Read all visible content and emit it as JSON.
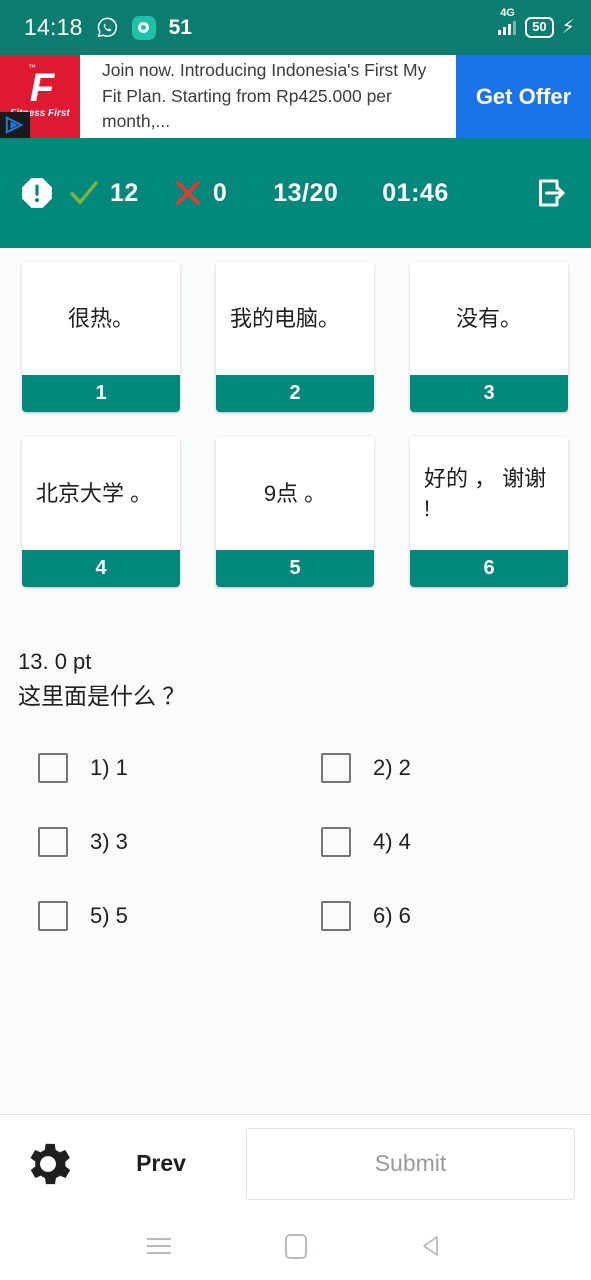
{
  "status_bar": {
    "time": "14:18",
    "whatsapp_icon": "whatsapp-icon",
    "message_icon": "message-icon",
    "notification_count": "51",
    "network_label": "4G",
    "battery_level": "50",
    "charging_icon": "charging-bolt-icon"
  },
  "ad_banner": {
    "brand": "Fitness First",
    "brand_mark": "F",
    "trademark": "™",
    "adchoices_icon": "adchoices-icon",
    "text": "Join now. Introducing Indonesia's First My Fit Plan. Starting from Rp425.000 per month,...",
    "cta_label": "Get Offer",
    "cta_color": "#1a73e8",
    "logo_color": "#e01933"
  },
  "quiz_header": {
    "alert_icon": "alert-octagon-icon",
    "correct_icon": "check-icon",
    "correct_count": "12",
    "wrong_icon": "cross-icon",
    "wrong_count": "0",
    "progress": "13/20",
    "timer": "01:46",
    "exit_icon": "exit-icon",
    "background_color": "#00897b",
    "correct_color": "#7cb342",
    "wrong_color": "#e53935"
  },
  "cards": [
    {
      "text": "很热。",
      "number": "1",
      "align": "center"
    },
    {
      "text": "我的电脑。",
      "number": "2",
      "align": "left"
    },
    {
      "text": "没有。",
      "number": "3",
      "align": "center"
    },
    {
      "text": "北京大学 。",
      "number": "4",
      "align": "left"
    },
    {
      "text": "9点 。",
      "number": "5",
      "align": "center"
    },
    {
      "text": "好的 ， 谢谢 !",
      "number": "6",
      "align": "left"
    }
  ],
  "question": {
    "points": "13. 0 pt",
    "text": "这里面是什么 ？",
    "options": [
      {
        "label": "1) 1",
        "checked": false
      },
      {
        "label": "2) 2",
        "checked": false
      },
      {
        "label": "3) 3",
        "checked": false
      },
      {
        "label": "4) 4",
        "checked": false
      },
      {
        "label": "5) 5",
        "checked": false
      },
      {
        "label": "6) 6",
        "checked": false
      }
    ]
  },
  "bottom_bar": {
    "settings_icon": "gear-icon",
    "prev_label": "Prev",
    "submit_label": "Submit"
  },
  "nav_bar": {
    "recent_icon": "recent-apps-icon",
    "home_icon": "home-icon",
    "back_icon": "back-icon"
  }
}
